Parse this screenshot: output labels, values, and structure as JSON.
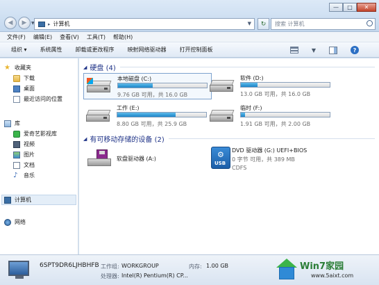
{
  "window": {
    "address": {
      "icon": "computer-icon",
      "path": "计算机"
    },
    "search_placeholder": "搜索 计算机",
    "controls": {
      "minimize": "—",
      "maximize": "□",
      "close": "✕"
    }
  },
  "menubar": [
    "文件(F)",
    "编辑(E)",
    "查看(V)",
    "工具(T)",
    "帮助(H)"
  ],
  "toolbar": {
    "organize": "组织 ▾",
    "items": [
      "系统属性",
      "卸载或更改程序",
      "映射网络驱动器",
      "打开控制面板"
    ]
  },
  "sidebar": {
    "favorites": {
      "label": "收藏夹",
      "items": [
        "下载",
        "桌面",
        "最近访问的位置"
      ]
    },
    "library": {
      "label": "库",
      "items": [
        "爱奇艺影视库",
        "视频",
        "图片",
        "文档",
        "音乐"
      ]
    },
    "computer": "计算机",
    "network": "网络"
  },
  "main": {
    "hard_disks": {
      "header": "硬盘 (4)",
      "drives": [
        {
          "name": "本地磁盘 (C:)",
          "info": "9.76 GB 可用，共 16.0 GB",
          "used_fraction": 0.39,
          "system": true
        },
        {
          "name": "软件 (D:)",
          "info": "13.0 GB 可用，共 16.0 GB",
          "used_fraction": 0.19,
          "system": false
        },
        {
          "name": "工作 (E:)",
          "info": "8.80 GB 可用，共 25.9 GB",
          "used_fraction": 0.66,
          "system": false
        },
        {
          "name": "临时 (F:)",
          "info": "1.91 GB 可用，共 2.00 GB",
          "used_fraction": 0.05,
          "system": false
        }
      ]
    },
    "removable": {
      "header": "有可移动存储的设备 (2)",
      "floppy": {
        "name": "软盘驱动器 (A:)"
      },
      "dvd": {
        "name": "DVD 驱动器 (G:) UEFI+BIOS",
        "info": "0 字节 可用，共 389 MB",
        "fs": "CDFS",
        "icon_text": "USB"
      }
    }
  },
  "details": {
    "computer_name": "6SPT9DR6LJHBHFB",
    "workgroup_label": "工作组:",
    "workgroup": "WORKGROUP",
    "memory_label": "内存:",
    "memory": "1.00 GB",
    "processor_label": "处理器:",
    "processor": "Intel(R) Pentium(R) CP..."
  },
  "watermark": {
    "title": "Win7家园",
    "url": "www.5aixt.com"
  }
}
